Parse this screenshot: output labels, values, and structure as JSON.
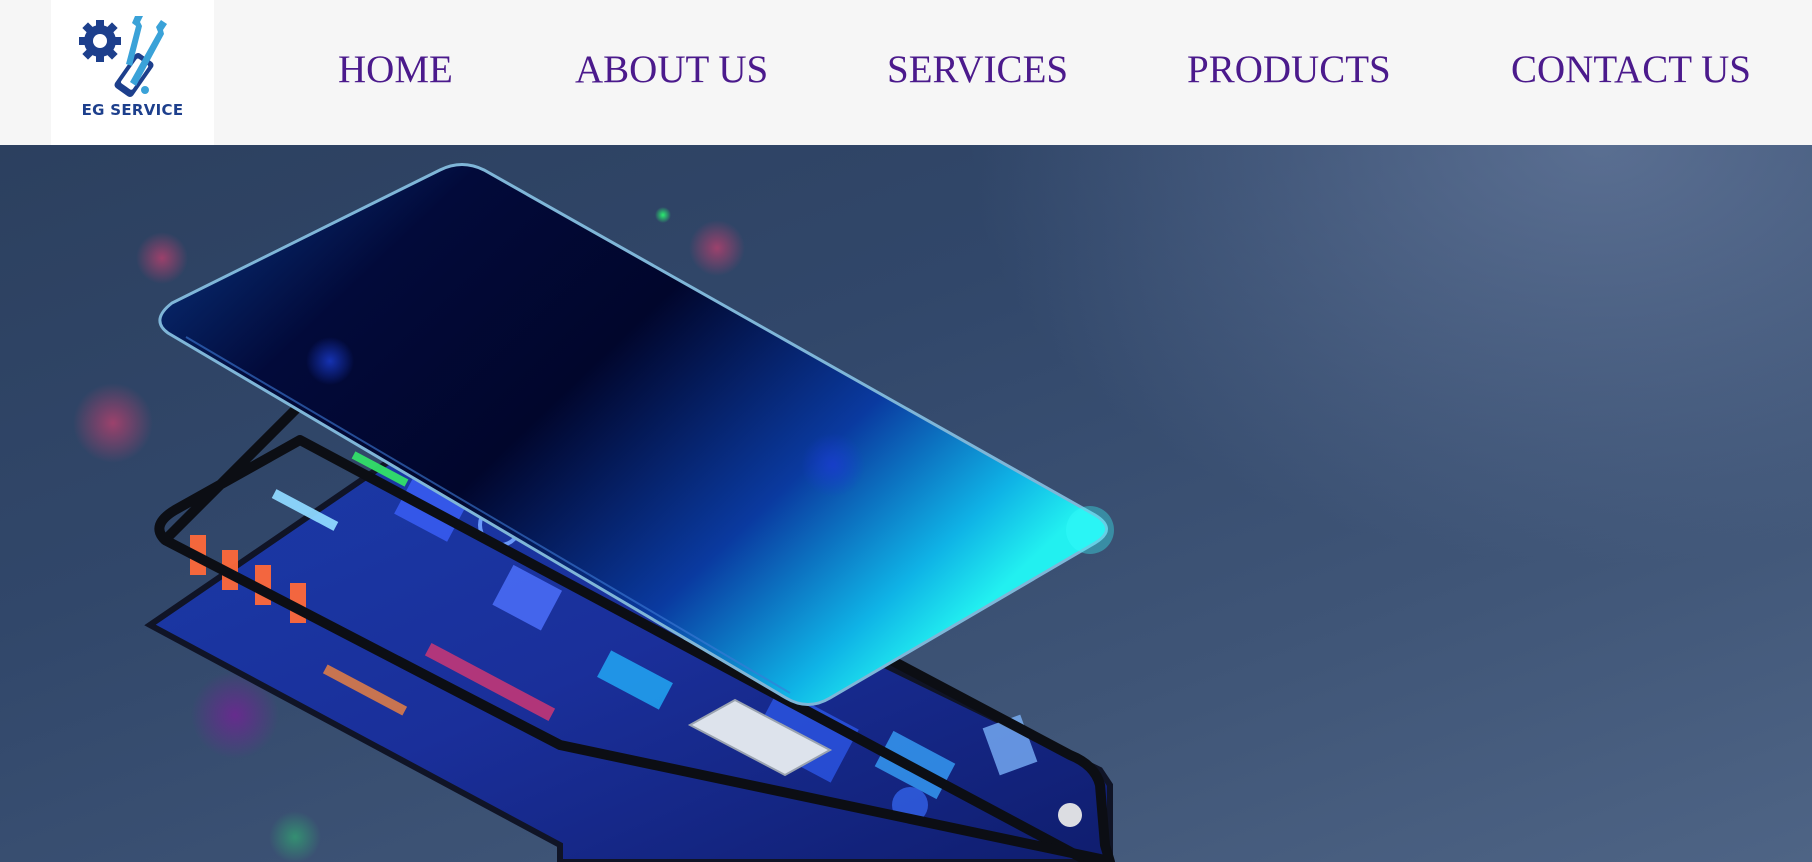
{
  "brand": {
    "name": "EG SERVICE",
    "logo_icon": "gear-wrench-phone-icon"
  },
  "nav": {
    "items": [
      {
        "label": "HOME"
      },
      {
        "label": "ABOUT US"
      },
      {
        "label": "SERVICES"
      },
      {
        "label": "PRODUCTS"
      },
      {
        "label": "CONTACT US"
      }
    ]
  },
  "hero": {
    "image": "isometric-smartphone-layers-illustration"
  },
  "colors": {
    "nav_text": "#4b1a8c",
    "header_bg": "#f6f6f6",
    "logo_text": "#1d3f8c",
    "hero_bg": "#33496c"
  }
}
